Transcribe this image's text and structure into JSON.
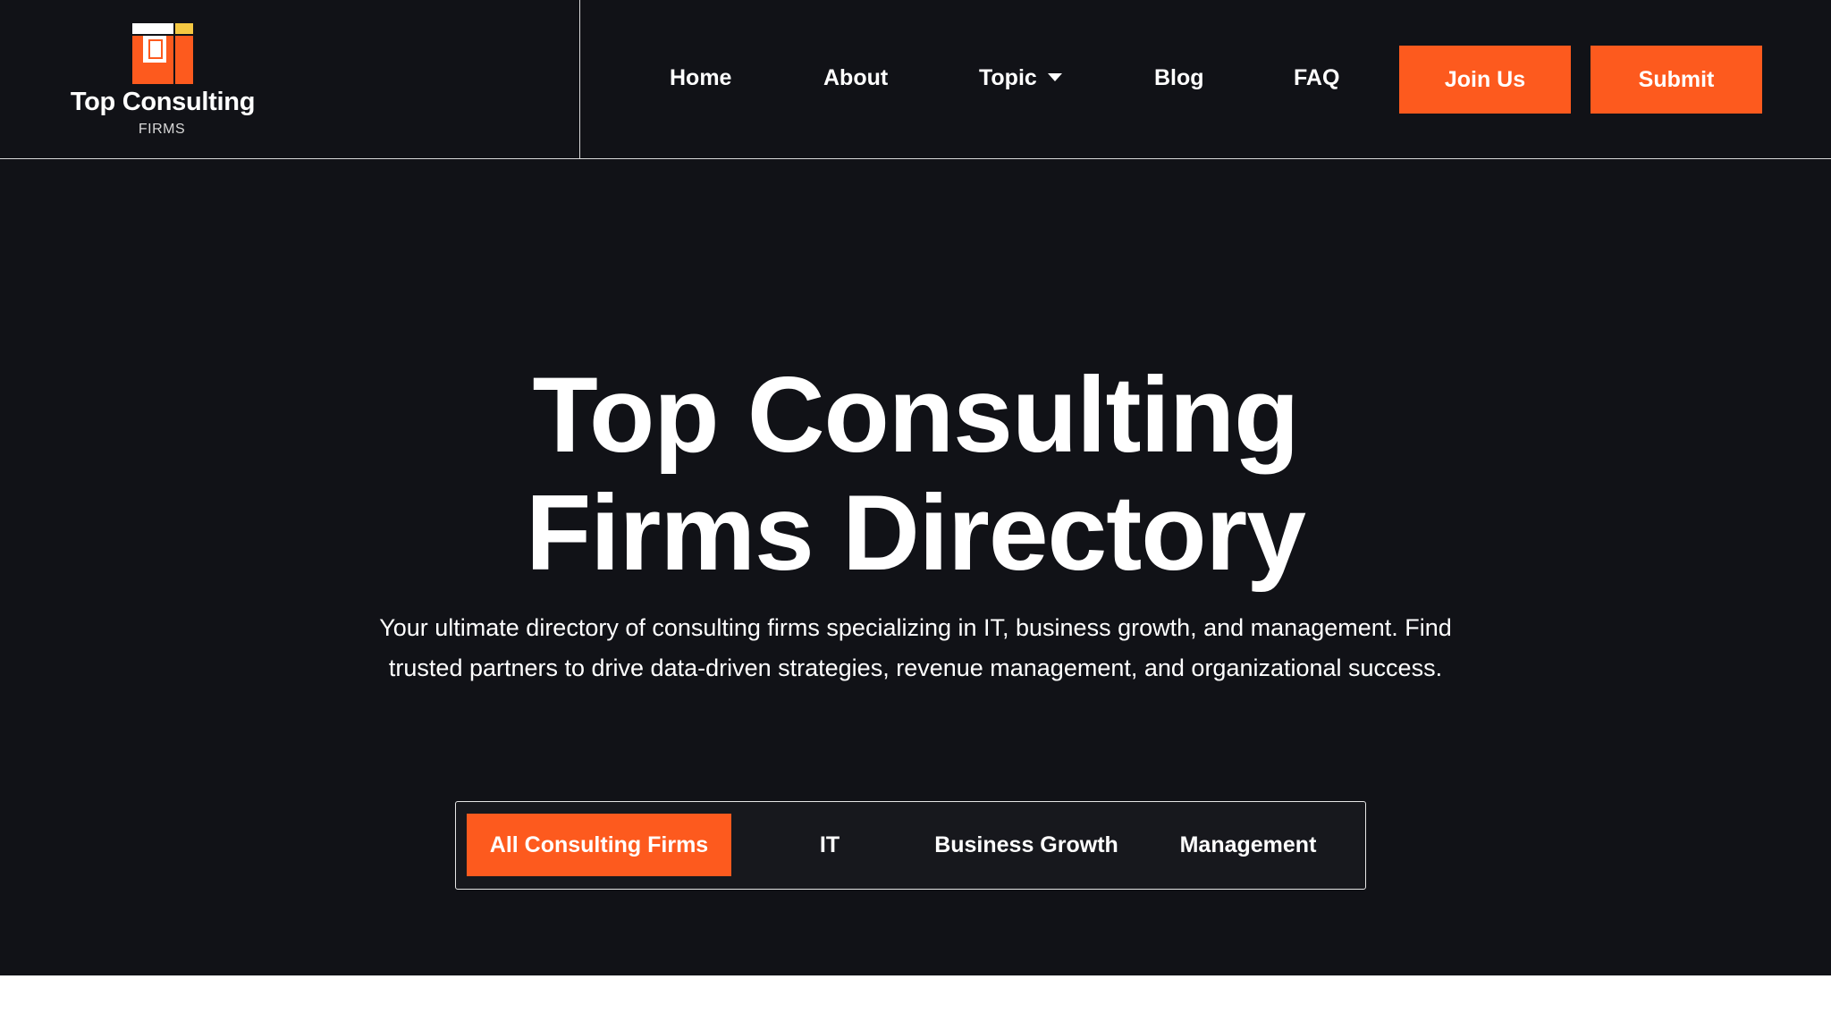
{
  "brand": {
    "title": "Top Consulting",
    "subtitle": "FIRMS",
    "logo_icon": "window-blocks-logo-icon",
    "colors": {
      "accent": "#fd5a1e",
      "accent_secondary": "#f5c842",
      "background": "#111217",
      "text": "#ffffff"
    }
  },
  "nav": {
    "home": "Home",
    "about": "About",
    "topic": "Topic",
    "blog": "Blog",
    "faq": "FAQ",
    "join": "Join Us",
    "submit": "Submit"
  },
  "hero": {
    "title_line1": "Top Consulting",
    "title_line2": "Firms Directory",
    "description": "Your ultimate directory of consulting firms specializing in IT, business growth, and management. Find trusted partners to drive data-driven strategies, revenue management, and organizational success."
  },
  "tabs": {
    "active": "All Consulting Firms",
    "items": [
      "All Consulting Firms",
      "IT",
      "Business Growth",
      "Management"
    ]
  }
}
